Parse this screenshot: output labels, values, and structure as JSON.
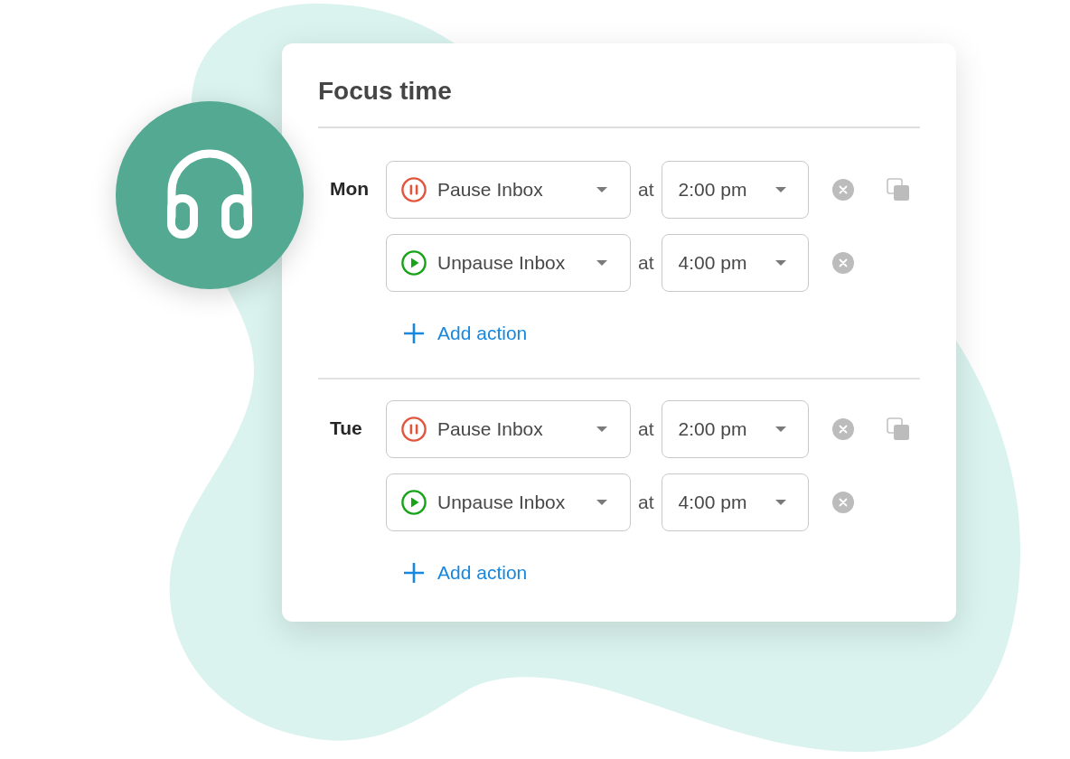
{
  "card": {
    "title": "Focus time"
  },
  "days": [
    {
      "label": "Mon",
      "actions": [
        {
          "kind": "pause",
          "label": "Pause Inbox",
          "connector": "at",
          "time": "2:00 pm"
        },
        {
          "kind": "unpause",
          "label": "Unpause Inbox",
          "connector": "at",
          "time": "4:00 pm"
        }
      ],
      "add_action": "Add action"
    },
    {
      "label": "Tue",
      "actions": [
        {
          "kind": "pause",
          "label": "Pause Inbox",
          "connector": "at",
          "time": "2:00 pm"
        },
        {
          "kind": "unpause",
          "label": "Unpause Inbox",
          "connector": "at",
          "time": "4:00 pm"
        }
      ],
      "add_action": "Add action"
    }
  ]
}
